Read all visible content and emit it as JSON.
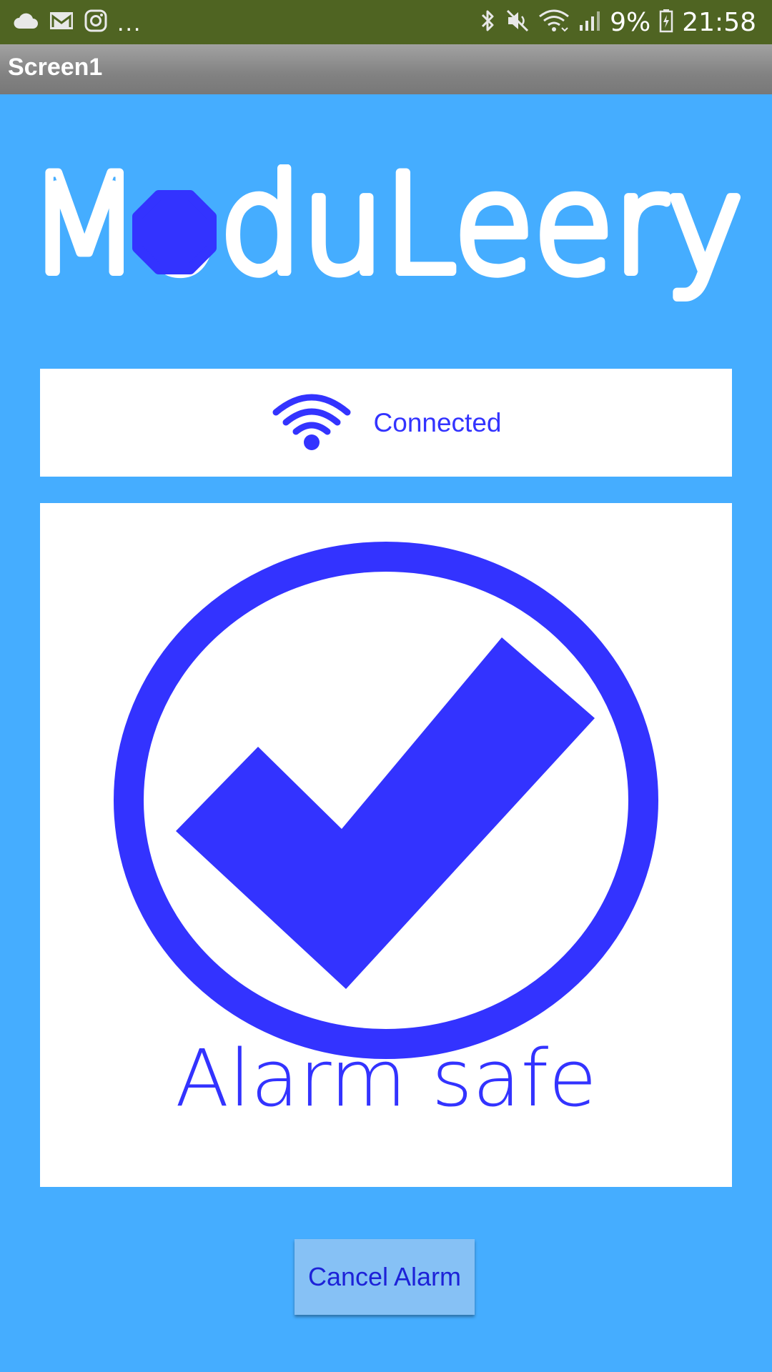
{
  "status_bar": {
    "more_indicator": "...",
    "battery_percent": "9%",
    "time": "21:58",
    "icons_left": [
      "cloud-icon",
      "gmail-icon",
      "instagram-icon"
    ],
    "icons_right": [
      "bluetooth-icon",
      "mute-icon",
      "wifi-icon",
      "signal-icon",
      "battery-icon"
    ],
    "background_color": "#4f6422"
  },
  "title_bar": {
    "title": "Screen1"
  },
  "logo": {
    "text": "ModuLeery",
    "accent_color": "#3333ff"
  },
  "connection": {
    "icon": "wifi-icon",
    "status": "Connected"
  },
  "alarm": {
    "icon": "check-circle-icon",
    "status": "Alarm safe",
    "color": "#3333ff"
  },
  "actions": {
    "cancel_label": "Cancel Alarm"
  },
  "colors": {
    "background": "#45adff",
    "card": "#ffffff",
    "accent": "#3333ff",
    "button": "#86c1f5"
  }
}
